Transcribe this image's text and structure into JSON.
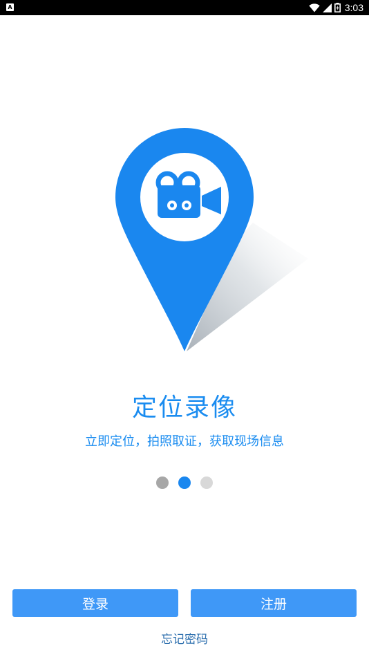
{
  "status_bar": {
    "app_icon_letter": "A",
    "time": "3:03",
    "icons": [
      "wifi-icon",
      "cell-signal-icon",
      "battery-icon"
    ]
  },
  "onboarding": {
    "illustration": "location-pin-video-camera-icon",
    "title": "定位录像",
    "subtitle": "立即定位，拍照取证，获取现场信息",
    "pager": {
      "page_count": 3,
      "active_index": 1,
      "colors": {
        "active": "#1a87ef",
        "first": "#a7a7a7",
        "inactive": "#d8d8d8"
      }
    }
  },
  "actions": {
    "login_label": "登录",
    "register_label": "注册",
    "forgot_password_label": "忘记密码"
  },
  "colors": {
    "accent": "#1a8cf0",
    "button": "#3f98f7",
    "link": "#2d6fae"
  }
}
